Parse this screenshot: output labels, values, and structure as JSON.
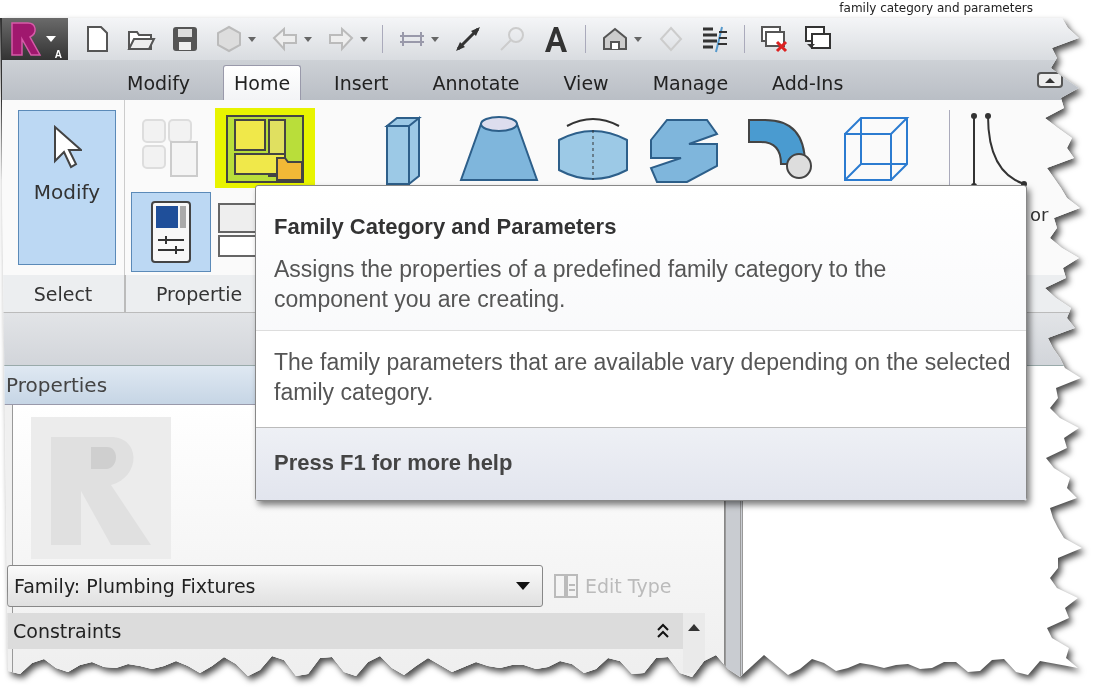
{
  "caption": "family category and parameters",
  "quick_access": {
    "app_menu_letter": "A"
  },
  "tabs": [
    {
      "label": "Modify",
      "selected": false
    },
    {
      "label": "Home",
      "selected": true
    },
    {
      "label": "Insert",
      "selected": false
    },
    {
      "label": "Annotate",
      "selected": false
    },
    {
      "label": "View",
      "selected": false
    },
    {
      "label": "Manage",
      "selected": false
    },
    {
      "label": "Add-Ins",
      "selected": false
    }
  ],
  "ribbon": {
    "modify_button": {
      "label": "Modify",
      "selected": true
    },
    "properties_button": {
      "selected": true
    },
    "family_category_button": {
      "highlighted": true
    },
    "cut_label": "or",
    "groups": [
      {
        "label": "Select"
      },
      {
        "label": "Propertie"
      }
    ]
  },
  "tooltip": {
    "title": "Family Category and Parameters",
    "description": "Assigns the properties of a predefined family category to the component you are creating.",
    "extended": "The family parameters that are available vary depending on the selected family category.",
    "footer": "Press F1 for more help"
  },
  "properties": {
    "title": "Properties",
    "type_selector": "Family: Plumbing Fixtures",
    "edit_type": {
      "label": "Edit Type",
      "disabled": true
    },
    "sections": [
      {
        "label": "Constraints",
        "expanded": true
      }
    ]
  }
}
